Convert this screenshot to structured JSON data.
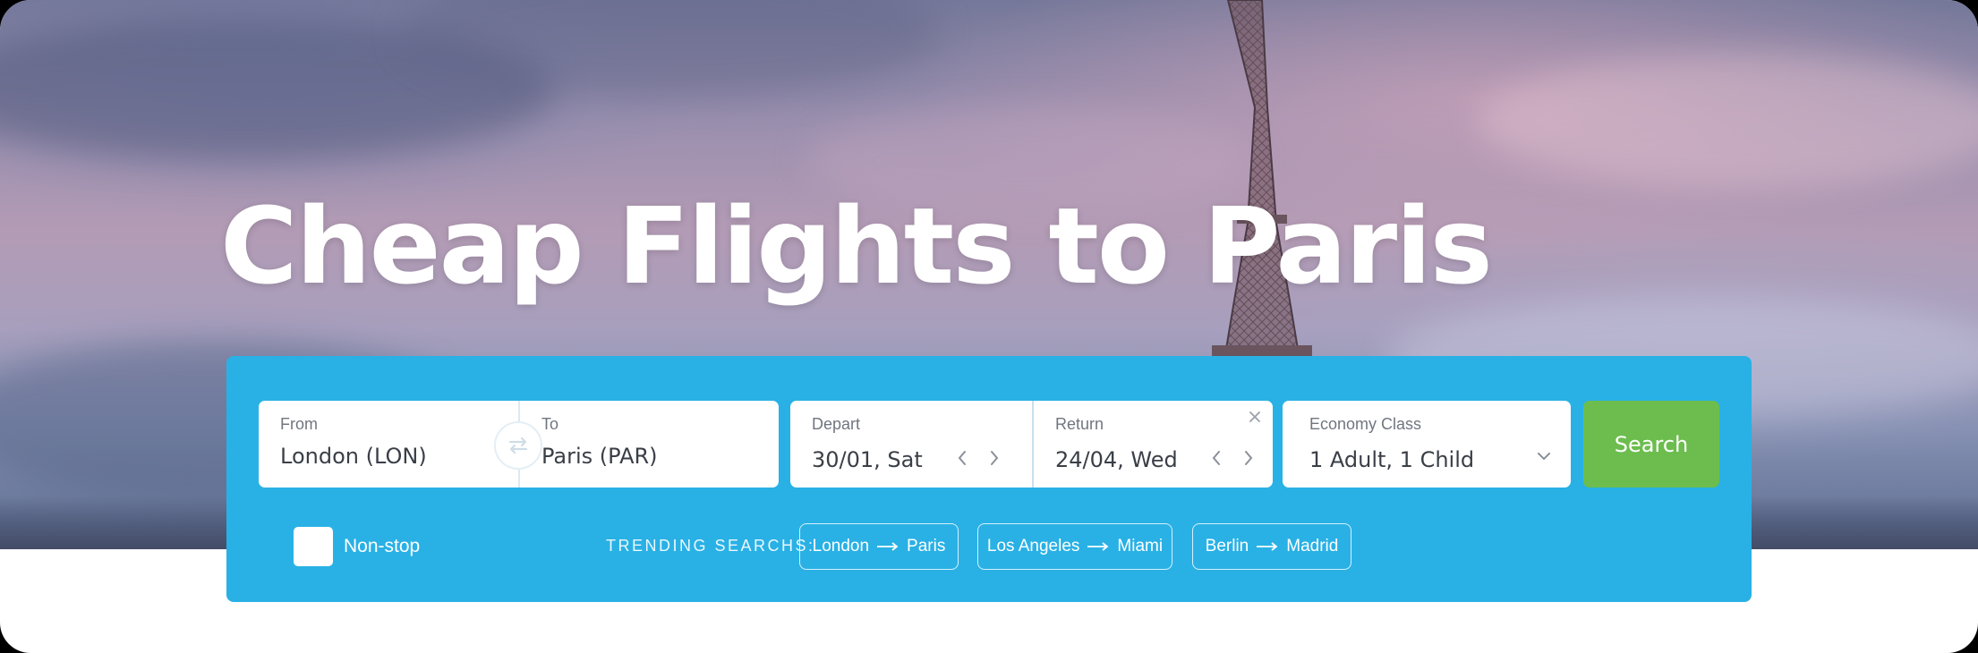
{
  "hero": {
    "title": "Cheap Flights to Paris"
  },
  "search": {
    "from": {
      "label": "From",
      "value": "London (LON)"
    },
    "to": {
      "label": "To",
      "value": "Paris (PAR)"
    },
    "depart": {
      "label": "Depart",
      "value": "30/01, Sat"
    },
    "return": {
      "label": "Return",
      "value": "24/04, Wed"
    },
    "travellers": {
      "label": "Economy Class",
      "value": "1 Adult, 1 Child"
    },
    "search_label": "Search",
    "nonstop_label": "Non-stop",
    "nonstop_checked": false
  },
  "trending": {
    "label": "TRENDING SEARCHS:",
    "items": [
      {
        "from": "London",
        "to": "Paris"
      },
      {
        "from": "Los Angeles",
        "to": "Miami"
      },
      {
        "from": "Berlin",
        "to": "Madrid"
      }
    ]
  },
  "icons": {
    "swap": "swap-arrows-icon",
    "prev": "chevron-left-icon",
    "next": "chevron-right-icon",
    "clear": "close-icon",
    "dropdown": "chevron-down-icon",
    "route_arrow": "long-arrow-right-icon"
  },
  "colors": {
    "panel": "#29b1e5",
    "search_button": "#6cbd4e",
    "text_dark": "#3a3f47",
    "text_muted": "#707680"
  }
}
